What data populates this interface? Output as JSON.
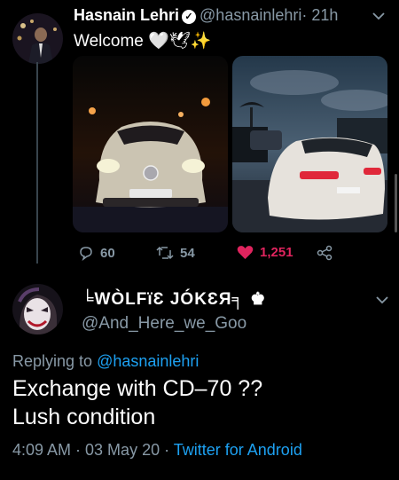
{
  "tweet1": {
    "author_name": "Hasnain Lehri",
    "handle": "@hasnainlehri",
    "time": "· 21h",
    "text": "Welcome 🤍🕊✨",
    "replies": "60",
    "retweets": "54",
    "likes": "1,251"
  },
  "tweet2": {
    "author_name": "╘WÒLFïƐ JÓKƐЯ╕ ♚",
    "handle": "@And_Here_we_Goo",
    "replying_label": "Replying to",
    "replying_to": "@hasnainlehri",
    "text_line1": "Exchange with CD–70 ??",
    "text_line2": "Lush condition",
    "timestamp": "4:09 AM · 03 May 20 · ",
    "source": "Twitter for Android"
  },
  "colors": {
    "background": "#000000",
    "secondary_text": "#8899a6",
    "link": "#1da1f2",
    "like": "#e0245e"
  },
  "icons": {
    "reply": "reply-icon",
    "retweet": "retweet-icon",
    "like": "heart-icon",
    "share": "share-icon",
    "verified": "verified-icon",
    "caret": "chevron-down-icon"
  }
}
